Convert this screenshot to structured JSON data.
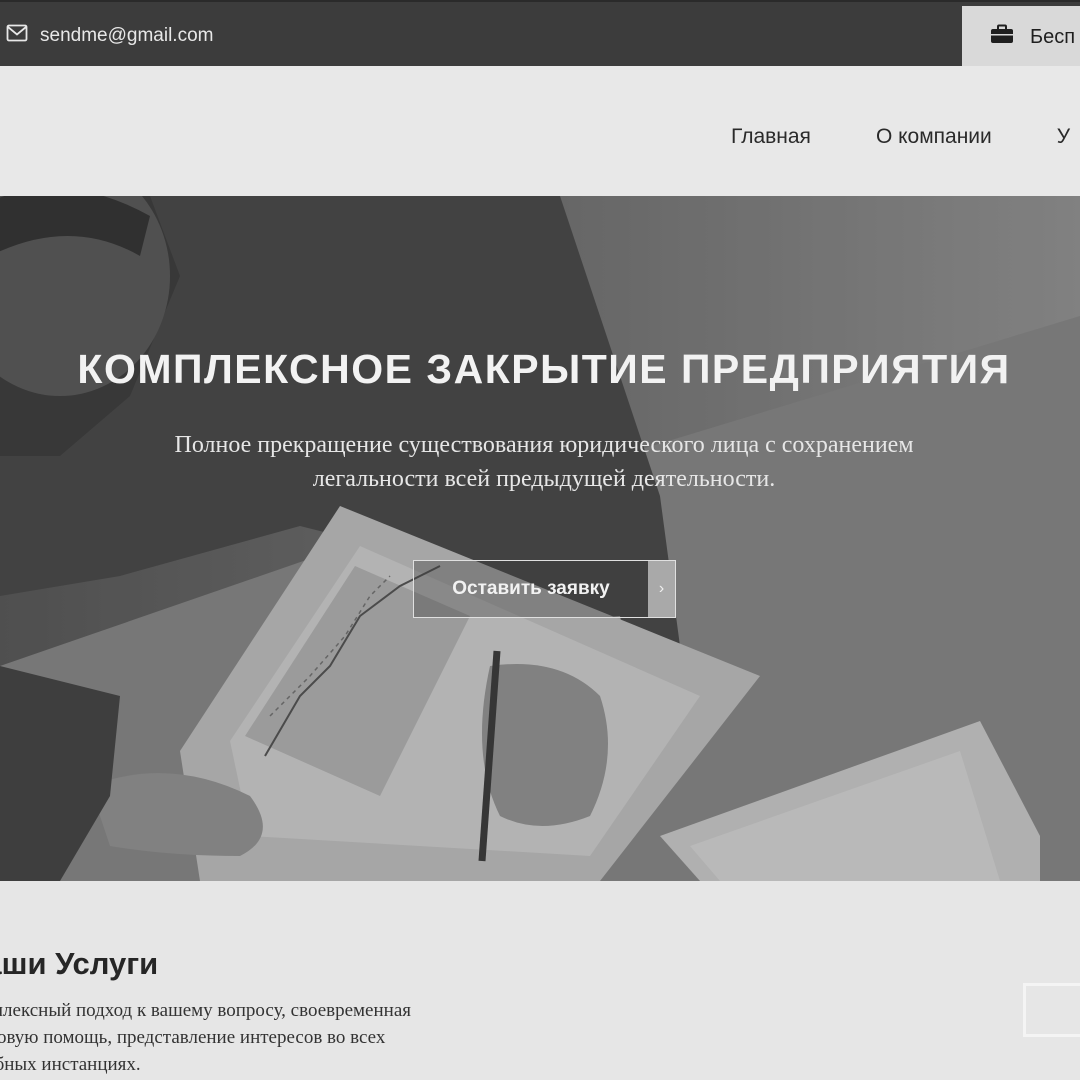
{
  "topbar": {
    "email": "sendme@gmail.com",
    "email_icon": "envelope-icon",
    "free_button_label": "Бесп",
    "free_button_icon": "briefcase-icon"
  },
  "nav": {
    "items": [
      {
        "label": "Главная"
      },
      {
        "label": "О компании"
      },
      {
        "label": "У"
      }
    ]
  },
  "hero": {
    "title": "КОМПЛЕКСНОЕ ЗАКРЫТИЕ ПРЕДПРИЯТИЯ",
    "subtitle_line1": "Полное прекращение существования юридического лица с сохранением",
    "subtitle_line2": "легальности всей предыдущей деятельности.",
    "cta_label": "Оставить заявку",
    "cta_arrow": "›"
  },
  "services": {
    "title": "Наши Услуги",
    "text_line1": "Комплексный подход к вашему вопросу, своевременная",
    "text_line2": "правовую помощь, представление интересов во всех",
    "text_line3": "судебных инстанциях."
  },
  "colors": {
    "topbar_bg": "#3c3c3c",
    "header_bg": "#e8e8e8",
    "page_bg": "#e6e6e6"
  }
}
